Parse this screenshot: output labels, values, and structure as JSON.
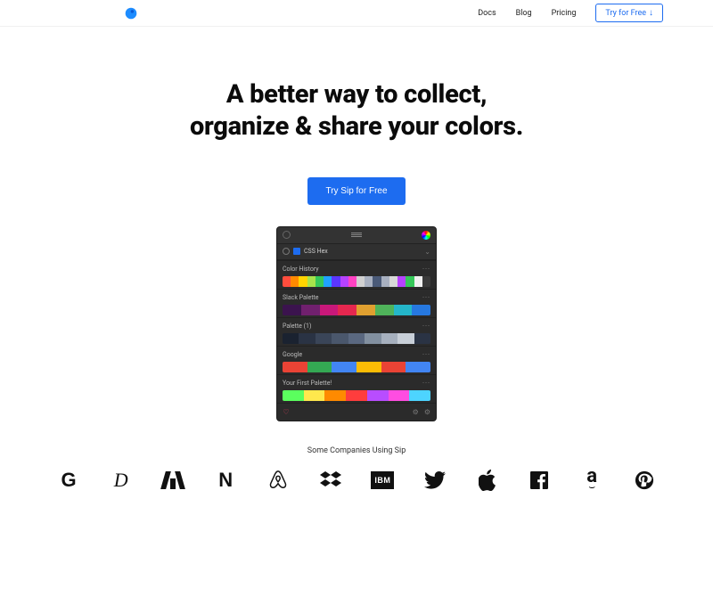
{
  "nav": {
    "items": [
      "Docs",
      "Blog",
      "Pricing"
    ],
    "try_label": "Try for Free",
    "try_arrow": "↓"
  },
  "hero": {
    "title_line1": "A better way to collect,",
    "title_line2": "organize & share your colors.",
    "cta_label": "Try Sip for Free"
  },
  "panel": {
    "format_label": "CSS Hex",
    "sections": [
      {
        "title": "Color History",
        "colors": [
          "#ff4d3d",
          "#ff8a00",
          "#ffd400",
          "#a7e34b",
          "#35c759",
          "#1fa2ff",
          "#5b36ff",
          "#b642ff",
          "#ff42c2",
          "#d0d0d0",
          "#a8b0c0",
          "#4a5a78",
          "#a8b0c0",
          "#d8d8d8",
          "#b642ff",
          "#35c759",
          "#f0f0f0",
          "#3a3a3a"
        ]
      },
      {
        "title": "Slack Palette",
        "colors": [
          "#3b134e",
          "#70206e",
          "#c9187a",
          "#e6274f",
          "#e0a030",
          "#4fb35a",
          "#24b6c9",
          "#2678e0"
        ]
      },
      {
        "title": "Palette (1)",
        "colors": [
          "#1a2230",
          "#2a3344",
          "#3a4558",
          "#4a576c",
          "#5a6880",
          "#8290a0",
          "#a6b0be",
          "#c8cfd8",
          "#2a3344"
        ]
      },
      {
        "title": "Google",
        "colors": [
          "#ea4335",
          "#34a853",
          "#4285f4",
          "#fbbc05",
          "#ea4335",
          "#4285f4"
        ]
      },
      {
        "title": "Your First Palette!",
        "colors": [
          "#5bff5e",
          "#ffe84d",
          "#ff8a00",
          "#ff3d3d",
          "#b84dff",
          "#ff4de1",
          "#4dd4ff"
        ]
      }
    ]
  },
  "companies": {
    "caption": "Some Companies Using Sip",
    "list": [
      "Google",
      "Disney",
      "Adobe",
      "Netflix",
      "Airbnb",
      "Dropbox",
      "IBM",
      "Twitter",
      "Apple",
      "Facebook",
      "Amazon",
      "Pinterest"
    ]
  },
  "colors": {
    "accent": "#1d6cf0"
  }
}
